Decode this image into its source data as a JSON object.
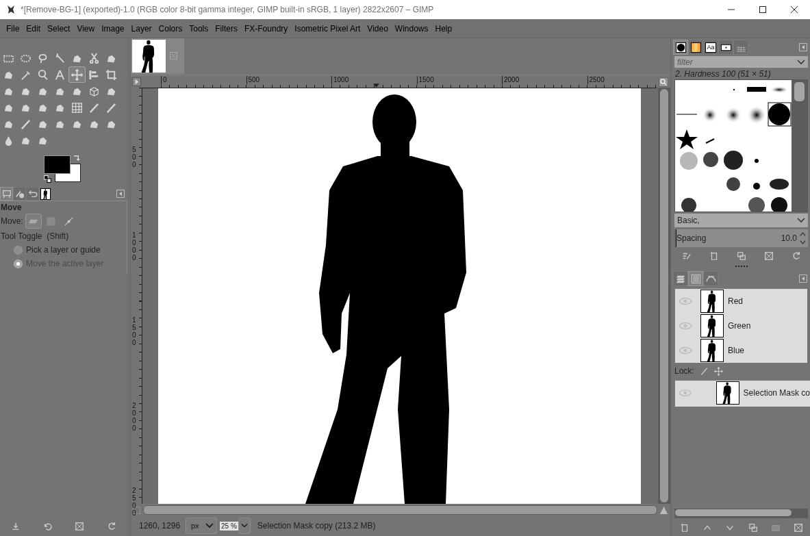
{
  "window": {
    "title": "*[Remove-BG-1] (exported)-1.0 (RGB color 8-bit gamma integer, GIMP built-in sRGB, 1 layer) 2822x2607 – GIMP"
  },
  "menu": [
    "File",
    "Edit",
    "Select",
    "View",
    "Image",
    "Layer",
    "Colors",
    "Tools",
    "Filters",
    "FX-Foundry",
    "Isometric Pixel Art",
    "Video",
    "Windows",
    "Help"
  ],
  "toolbox": {
    "tools": [
      {
        "selected": false
      },
      {
        "selected": false
      },
      {
        "selected": false
      },
      {
        "selected": false
      },
      {
        "selected": false
      },
      {
        "selected": false
      },
      {
        "selected": false
      },
      {
        "selected": false
      },
      {
        "selected": false
      },
      {
        "selected": false
      },
      {
        "selected": false
      },
      {
        "selected": true
      },
      {
        "selected": false
      },
      {
        "selected": false
      },
      {
        "selected": false
      },
      {
        "selected": false
      },
      {
        "selected": false
      },
      {
        "selected": false
      },
      {
        "selected": false
      },
      {
        "selected": false
      },
      {
        "selected": false
      },
      {
        "selected": false
      },
      {
        "selected": false
      },
      {
        "selected": false
      },
      {
        "selected": false
      },
      {
        "selected": false
      },
      {
        "selected": false
      },
      {
        "selected": false
      },
      {
        "selected": false
      },
      {
        "selected": false
      },
      {
        "selected": false
      },
      {
        "selected": false
      },
      {
        "selected": false
      },
      {
        "selected": false
      },
      {
        "selected": false
      },
      {
        "selected": false
      },
      {
        "selected": false
      },
      {
        "selected": false
      }
    ]
  },
  "left_dock": {
    "tabs": [
      {
        "kind": "options",
        "selected": true
      },
      {
        "kind": "device",
        "selected": false
      },
      {
        "kind": "undo",
        "selected": false
      },
      {
        "kind": "images",
        "selected": false
      }
    ]
  },
  "tool_options": {
    "title": "Move",
    "move_label": "Move:",
    "move_modes": [
      {
        "kind": "layer",
        "selected": true
      },
      {
        "kind": "selection",
        "selected": false
      },
      {
        "kind": "path",
        "selected": false
      }
    ],
    "toggle_label": "Tool Toggle  (Shift)",
    "radios": [
      {
        "label": "Pick a layer or guide",
        "selected": false,
        "disabled": false
      },
      {
        "label": "Move the active layer",
        "selected": true,
        "disabled": true
      }
    ]
  },
  "image_tabs": [
    {
      "selected": true
    }
  ],
  "rulers": {
    "horizontal": [
      "0",
      "500",
      "1000",
      "1500",
      "2000",
      "2500"
    ],
    "vertical": [
      "500",
      "1000",
      "1500",
      "2000",
      "2500"
    ]
  },
  "status_bar": {
    "pointer": "1260, 1296",
    "unit": "px",
    "zoom": "25 %",
    "message": "Selection Mask copy (213.2 MB)"
  },
  "brushes": {
    "tabs": [
      {
        "kind": "brush",
        "selected": true
      },
      {
        "kind": "gradient",
        "selected": false
      },
      {
        "kind": "font",
        "label": "Aa",
        "selected": false
      },
      {
        "kind": "pattern",
        "selected": false
      },
      {
        "kind": "texture",
        "selected": false
      }
    ],
    "filter_placeholder": "filter",
    "brush_name": "2. Hardness 100 (51 × 51)",
    "tag": "Basic,",
    "spacing": {
      "label": "Spacing",
      "value": "10.0",
      "level": 0.01
    }
  },
  "channels": {
    "tabs": [
      {
        "kind": "layers",
        "selected": false
      },
      {
        "kind": "channels",
        "selected": true
      },
      {
        "kind": "paths",
        "selected": false
      }
    ],
    "items": [
      {
        "name": "Red"
      },
      {
        "name": "Green"
      },
      {
        "name": "Blue"
      }
    ],
    "lock_label": "Lock:",
    "masks": [
      {
        "name": "Selection Mask co"
      }
    ]
  }
}
